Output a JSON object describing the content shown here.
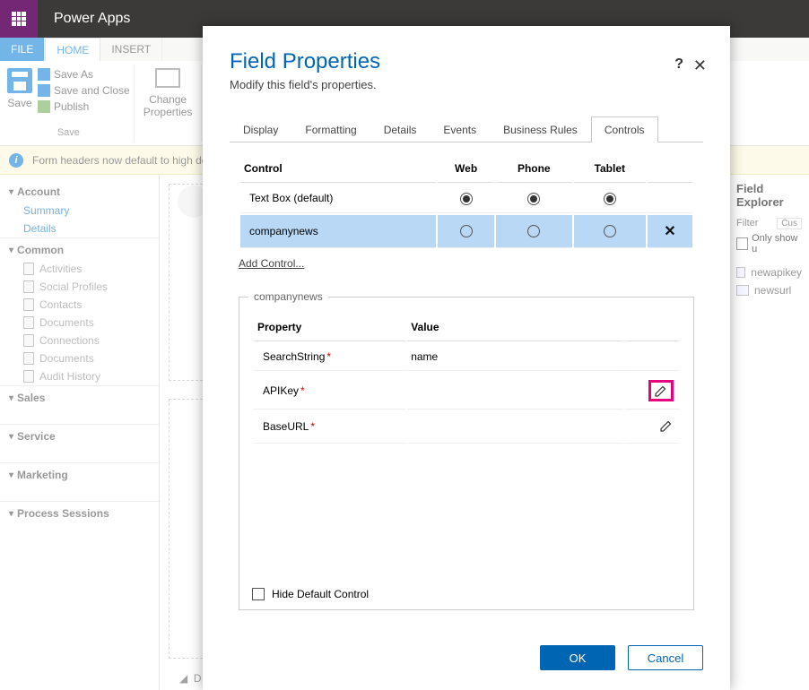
{
  "topbar": {
    "app_name": "Power Apps"
  },
  "ribbon": {
    "tabs": {
      "file": "FILE",
      "home": "HOME",
      "insert": "INSERT"
    },
    "save_label": "Save",
    "save_as": "Save As",
    "save_close": "Save and Close",
    "publish": "Publish",
    "group_save": "Save",
    "change_props": "Change\nProperties"
  },
  "infobar": {
    "text": "Form headers now default to high dens"
  },
  "left_nav": {
    "sections": {
      "account": "Account",
      "common": "Common",
      "sales": "Sales",
      "service": "Service",
      "marketing": "Marketing",
      "process": "Process Sessions"
    },
    "account_items": [
      "Summary",
      "Details"
    ],
    "common_items": [
      "Activities",
      "Social Profiles",
      "Contacts",
      "Documents",
      "Connections",
      "Documents",
      "Audit History"
    ]
  },
  "right": {
    "title": "Field Explorer",
    "filter": "Filter",
    "cus": "Cus",
    "only_show": "Only show u",
    "fields": [
      "newapikey",
      "newsurl"
    ]
  },
  "dialog": {
    "title": "Field Properties",
    "subtitle": "Modify this field's properties.",
    "tabs": [
      "Display",
      "Formatting",
      "Details",
      "Events",
      "Business Rules",
      "Controls"
    ],
    "active_tab": 5,
    "ctrl_headers": {
      "control": "Control",
      "web": "Web",
      "phone": "Phone",
      "tablet": "Tablet"
    },
    "ctrl_rows": [
      {
        "name": "Text Box (default)",
        "web": true,
        "phone": true,
        "tablet": true,
        "selected": false,
        "deletable": false
      },
      {
        "name": "companynews",
        "web": false,
        "phone": false,
        "tablet": false,
        "selected": true,
        "deletable": true
      }
    ],
    "add_control": "Add Control...",
    "fieldset_legend": "companynews",
    "prop_headers": {
      "property": "Property",
      "value": "Value"
    },
    "prop_rows": [
      {
        "name": "SearchString",
        "required": true,
        "value": "name",
        "edit": false,
        "highlight": false
      },
      {
        "name": "APIKey",
        "required": true,
        "value": "",
        "edit": true,
        "highlight": true
      },
      {
        "name": "BaseURL",
        "required": true,
        "value": "",
        "edit": true,
        "highlight": false
      }
    ],
    "hide_default": "Hide Default Control",
    "ok": "OK",
    "cancel": "Cancel"
  }
}
